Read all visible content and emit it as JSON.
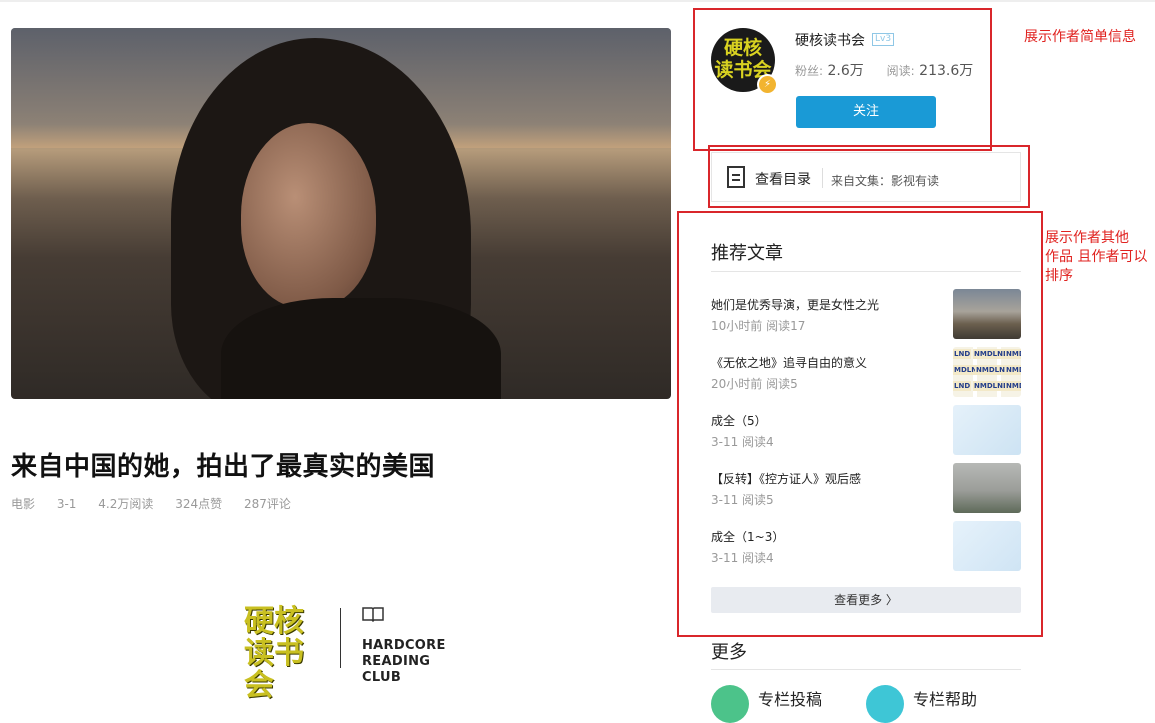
{
  "article": {
    "title": "来自中国的她，拍出了最真实的美国",
    "meta": [
      "电影",
      "3-1",
      "4.2万阅读",
      "324点赞",
      "287评论"
    ]
  },
  "logo": {
    "cn_line1": "硬核",
    "cn_line2": "读书会",
    "en_line1": "HARDCORE",
    "en_line2": "READING CLUB"
  },
  "author": {
    "name": "硬核读书会",
    "level": "Lv3",
    "fans_label": "粉丝:",
    "fans": "2.6万",
    "reads_label": "阅读:",
    "reads": "213.6万",
    "follow_label": "关注",
    "avatar_line1": "硬核",
    "avatar_line2": "读书会"
  },
  "catalog": {
    "label": "查看目录",
    "from": "来自文集：影视有读"
  },
  "recommend": {
    "title": "推荐文章",
    "items": [
      {
        "title": "她们是优秀导演，更是女性之光",
        "meta": "10小时前 阅读17"
      },
      {
        "title": "《无依之地》追寻自由的意义",
        "meta": "20小时前 阅读5"
      },
      {
        "title": "成全（5）",
        "meta": "3-11 阅读4"
      },
      {
        "title": "【反转】《控方证人》观后感",
        "meta": "3-11 阅读5"
      },
      {
        "title": "成全（1~3）",
        "meta": "3-11 阅读4"
      }
    ],
    "more_label": "查看更多 〉"
  },
  "more_section": {
    "title": "更多",
    "links": [
      "专栏投稿",
      "专栏帮助"
    ]
  },
  "annotations": {
    "author_info": "展示作者简单信息",
    "other_works_1": "展示作者其他",
    "other_works_2": "作品 且作者可以",
    "other_works_3": "排序"
  },
  "colors": {
    "annotation_red": "#d9262b",
    "follow_blue": "#1a9ad6",
    "logo_yellow": "#c9c021"
  }
}
